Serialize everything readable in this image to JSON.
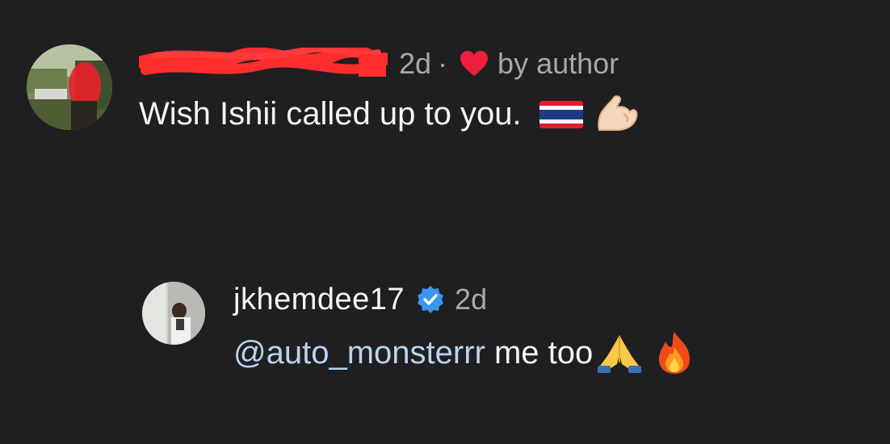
{
  "comments": [
    {
      "author_name_redacted": true,
      "time": "2d",
      "separator": "·",
      "liked_by_author_label": "by author",
      "text": "Wish Ishii called up to you.",
      "emojis": [
        "thailand-flag-icon",
        "flexed-biceps-icon"
      ]
    },
    {
      "username": "jkhemdee17",
      "verified": true,
      "time": "2d",
      "mention": "@auto_monsterrr",
      "text": " me too",
      "emojis": [
        "folded-hands-icon",
        "fire-icon"
      ]
    }
  ],
  "colors": {
    "background": "#1f1f21",
    "primary_text": "#f4f4f4",
    "secondary_text": "#a8a8a8",
    "heart": "#ed1f3d",
    "mention": "#b9d3ee",
    "verified": "#3897f0",
    "redaction": "#ff2e2e"
  }
}
